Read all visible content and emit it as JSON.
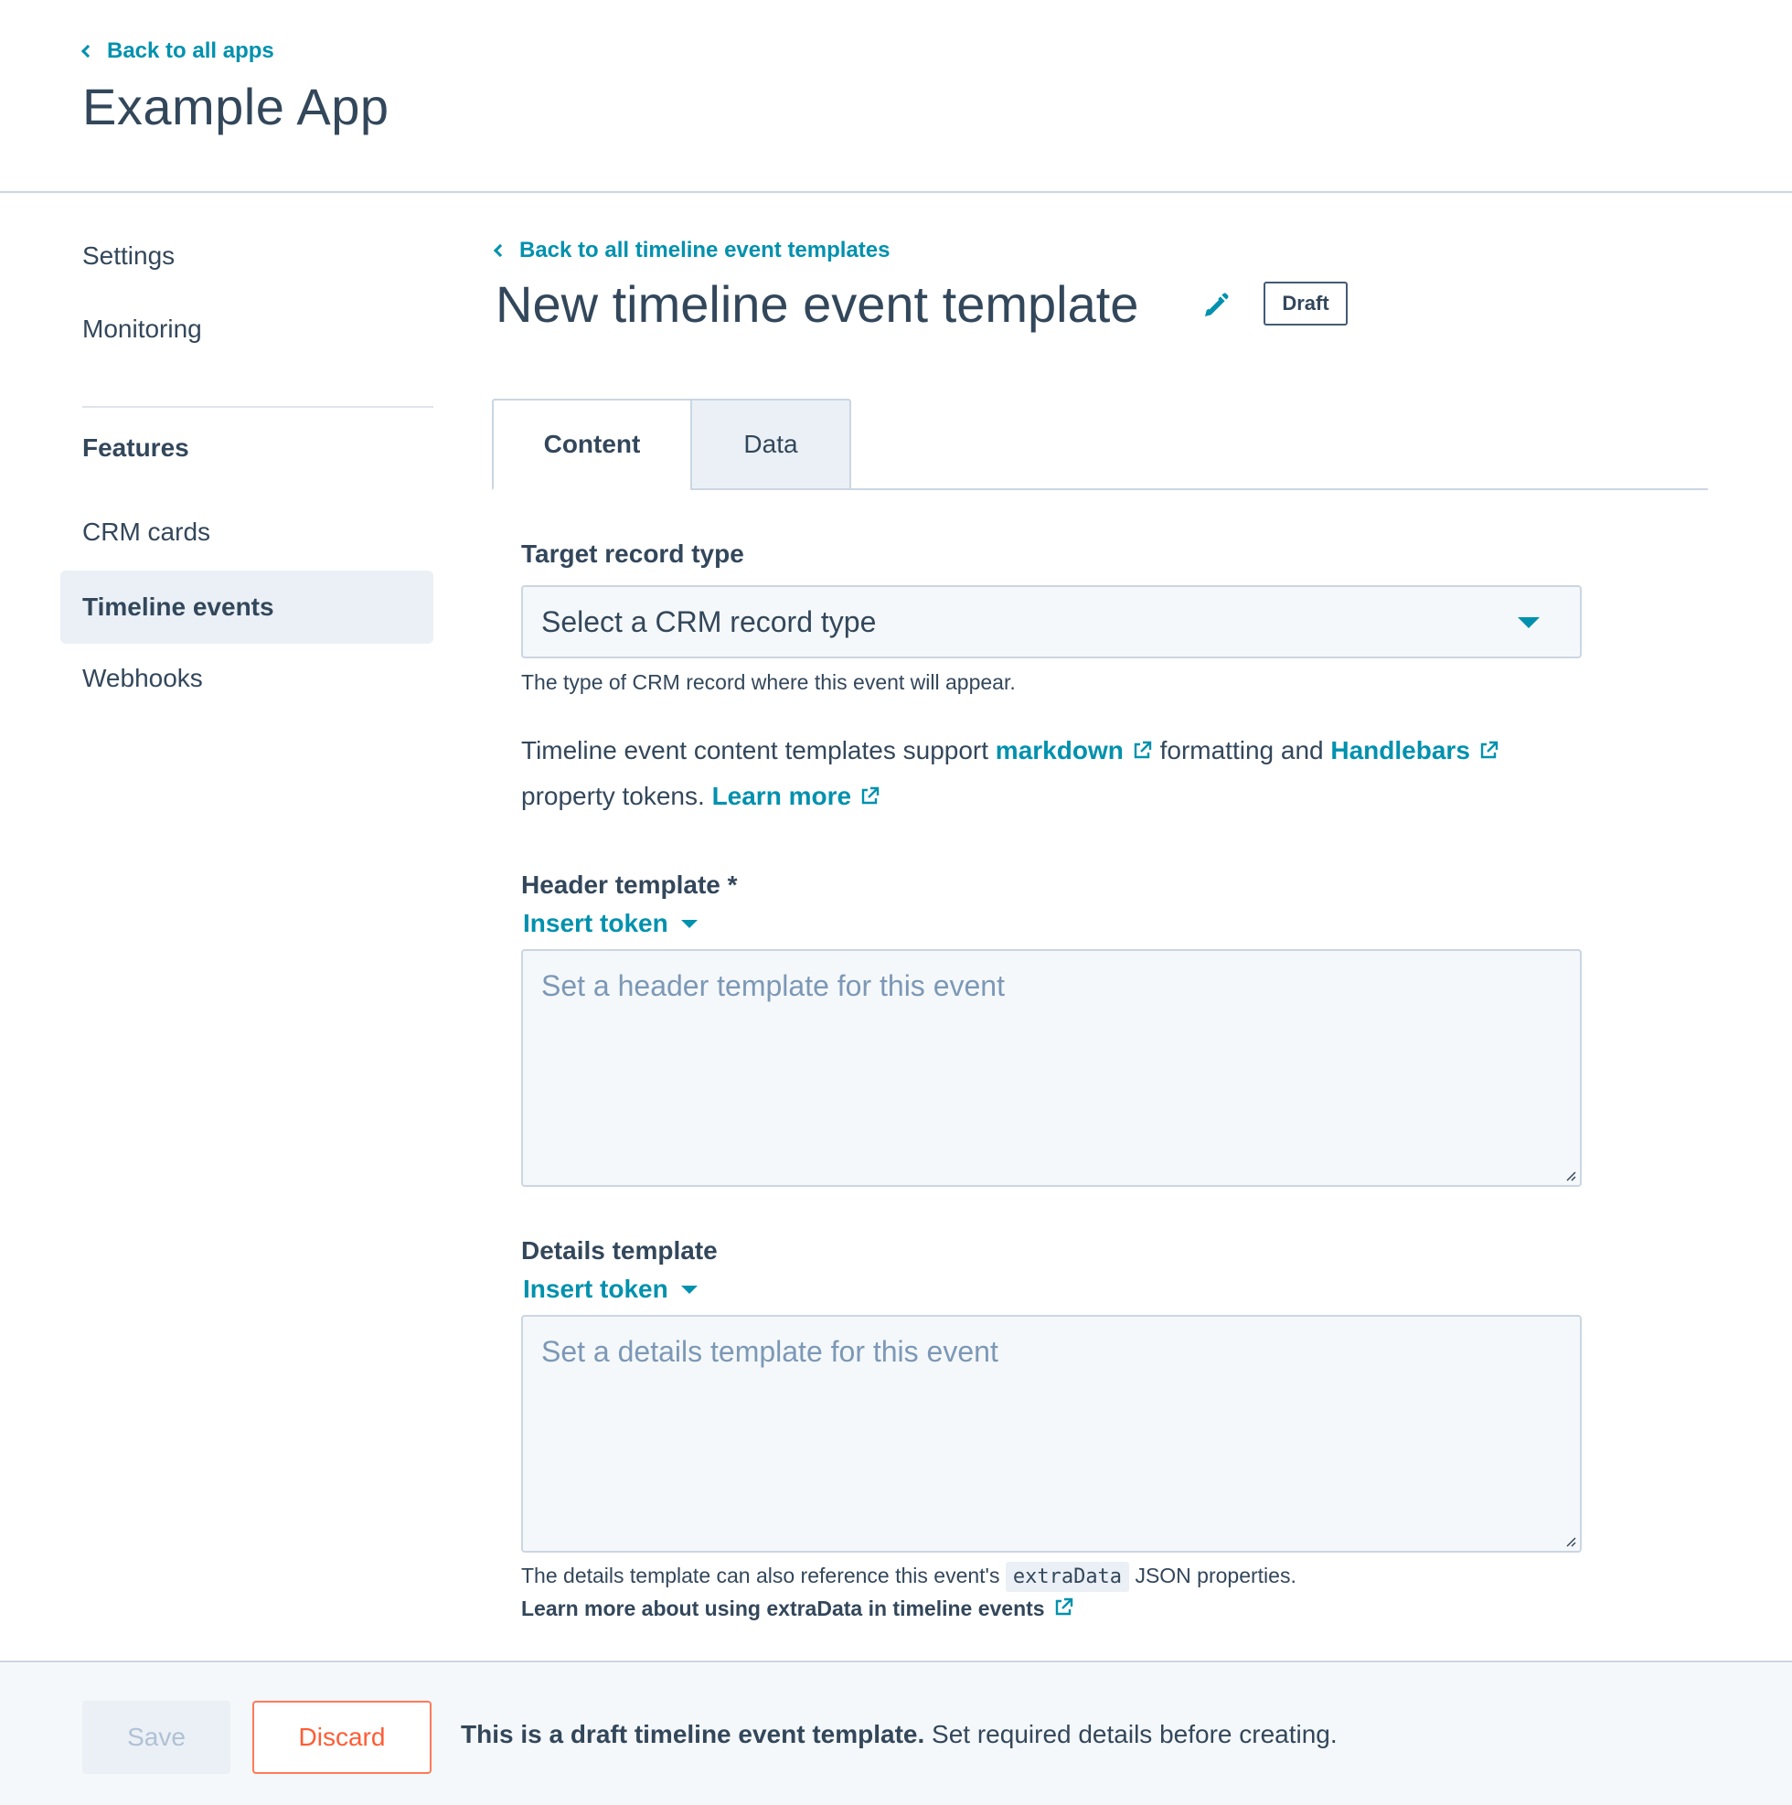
{
  "header": {
    "back_link": "Back to all apps",
    "app_title": "Example App"
  },
  "sidebar": {
    "items": [
      {
        "label": "Settings"
      },
      {
        "label": "Monitoring"
      }
    ],
    "section_heading": "Features",
    "feature_items": [
      {
        "label": "CRM cards"
      },
      {
        "label": "Timeline events",
        "active": true
      },
      {
        "label": "Webhooks"
      }
    ]
  },
  "main": {
    "back_link": "Back to all timeline event templates",
    "title": "New timeline event template",
    "status_badge": "Draft",
    "tabs": [
      {
        "label": "Content",
        "active": true
      },
      {
        "label": "Data"
      }
    ],
    "target_record": {
      "label": "Target record type",
      "select_value": "Select a CRM record type",
      "help": "The type of CRM record where this event will appear."
    },
    "info": {
      "prefix": "Timeline event content templates support",
      "markdown_link": "markdown",
      "middle": "formatting and",
      "handlebars_link": "Handlebars",
      "suffix": "property tokens.",
      "learn_more": "Learn more"
    },
    "header_template": {
      "label": "Header template *",
      "insert_token": "Insert token",
      "placeholder": "Set a header template for this event"
    },
    "details_template": {
      "label": "Details template",
      "insert_token": "Insert token",
      "placeholder": "Set a details template for this event",
      "help_prefix": "The details template can also reference this event's",
      "help_code": "extraData",
      "help_suffix": "JSON properties.",
      "help_link": "Learn more about using extraData in timeline events"
    }
  },
  "footer": {
    "save_label": "Save",
    "discard_label": "Discard",
    "message_bold": "This is a draft timeline event template.",
    "message_rest": "Set required details before creating."
  },
  "colors": {
    "accent": "#0091ae",
    "text": "#33475b",
    "discard": "#ff5c35",
    "border": "#cbd6e2"
  }
}
